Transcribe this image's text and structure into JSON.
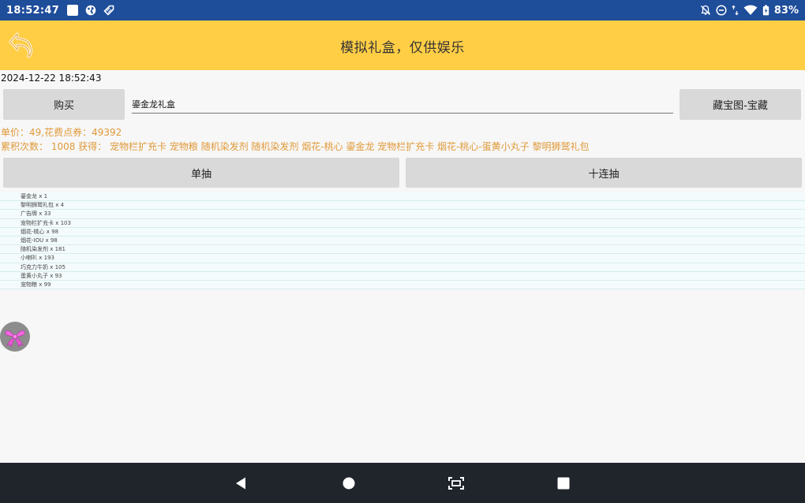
{
  "status_bar": {
    "time": "18:52:47",
    "battery": "83%"
  },
  "app_bar": {
    "title": "模拟礼盒，仅供娱乐"
  },
  "datetime": "2024-12-22 18:52:43",
  "buttons": {
    "buy": "购买",
    "treasure_map": "藏宝图-宝藏",
    "single_draw": "单抽",
    "ten_draw": "十连抽"
  },
  "gift_input": {
    "value": "鎏金龙礼盒"
  },
  "price_line": "单价：49,花费点券：49392",
  "count_line": "累积次数： 1008 获得： 宠物栏扩充卡 宠物粮 随机染发剂 随机染发剂 烟花-桃心 鎏金龙 宠物栏扩充卡 烟花-桃心-蛋黄小丸子 黎明狮鹫礼包",
  "results": [
    "鎏金龙 x 1",
    "黎明狮鹫礼包 x 4",
    "广告牌 x 33",
    "宠物栏扩充卡 x 103",
    "烟花-桃心 x 98",
    "烟花-IOU x 98",
    "随机染发剂 x 181",
    "小喇叭 x 193",
    "巧克力牛奶 x 105",
    "蛋黄小丸子 x 93",
    "宠物粮 x 99"
  ],
  "icons": {
    "back": "back-arrow-icon",
    "float": "ribbon-icon",
    "nav_back": "triangle-back-icon",
    "nav_home": "circle-home-icon",
    "nav_screenshot": "screenshot-icon",
    "nav_recents": "square-recents-icon"
  },
  "colors": {
    "status_bar": "#1e4d9a",
    "app_bar": "#ffce45",
    "accent_text": "#e09a3a",
    "button": "#d9d9d9",
    "nav_bar": "#20242b"
  }
}
